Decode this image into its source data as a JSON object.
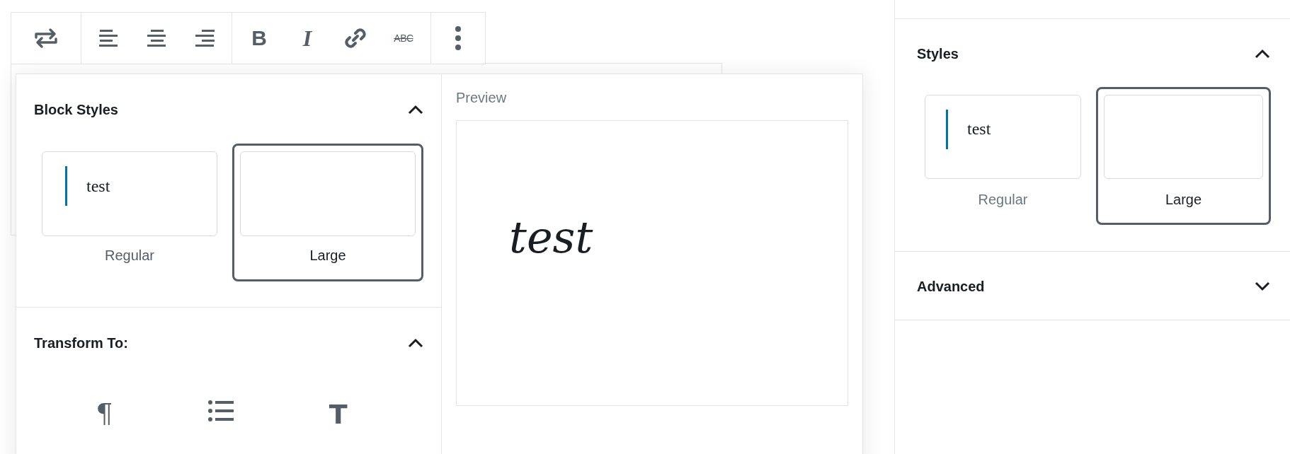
{
  "toolbar": {
    "groups": [
      [
        {
          "kind": "transform"
        }
      ],
      [
        {
          "kind": "align-left"
        },
        {
          "kind": "align-center"
        },
        {
          "kind": "align-right"
        }
      ],
      [
        {
          "kind": "bold",
          "glyph": "B"
        },
        {
          "kind": "italic",
          "glyph": "I"
        },
        {
          "kind": "link"
        },
        {
          "kind": "strikethrough",
          "glyph": "ABC"
        }
      ],
      [
        {
          "kind": "more"
        }
      ]
    ]
  },
  "popover": {
    "sections": [
      {
        "title": "Block Styles",
        "expanded": true,
        "styles": [
          {
            "label": "Regular",
            "sample": "test",
            "selected": false
          },
          {
            "label": "Large",
            "selected": true
          }
        ]
      },
      {
        "title": "Transform To:",
        "expanded": true,
        "transforms": [
          {
            "kind": "paragraph",
            "glyph": "¶"
          },
          {
            "kind": "list"
          },
          {
            "kind": "heading",
            "glyph": "T"
          }
        ]
      }
    ],
    "preview": {
      "label": "Preview",
      "text": "test"
    }
  },
  "sidebar": {
    "sections": [
      {
        "title": "Styles",
        "expanded": true,
        "styles": [
          {
            "label": "Regular",
            "sample": "test",
            "selected": false
          },
          {
            "label": "Large",
            "selected": true
          }
        ]
      },
      {
        "title": "Advanced",
        "expanded": false
      }
    ]
  }
}
